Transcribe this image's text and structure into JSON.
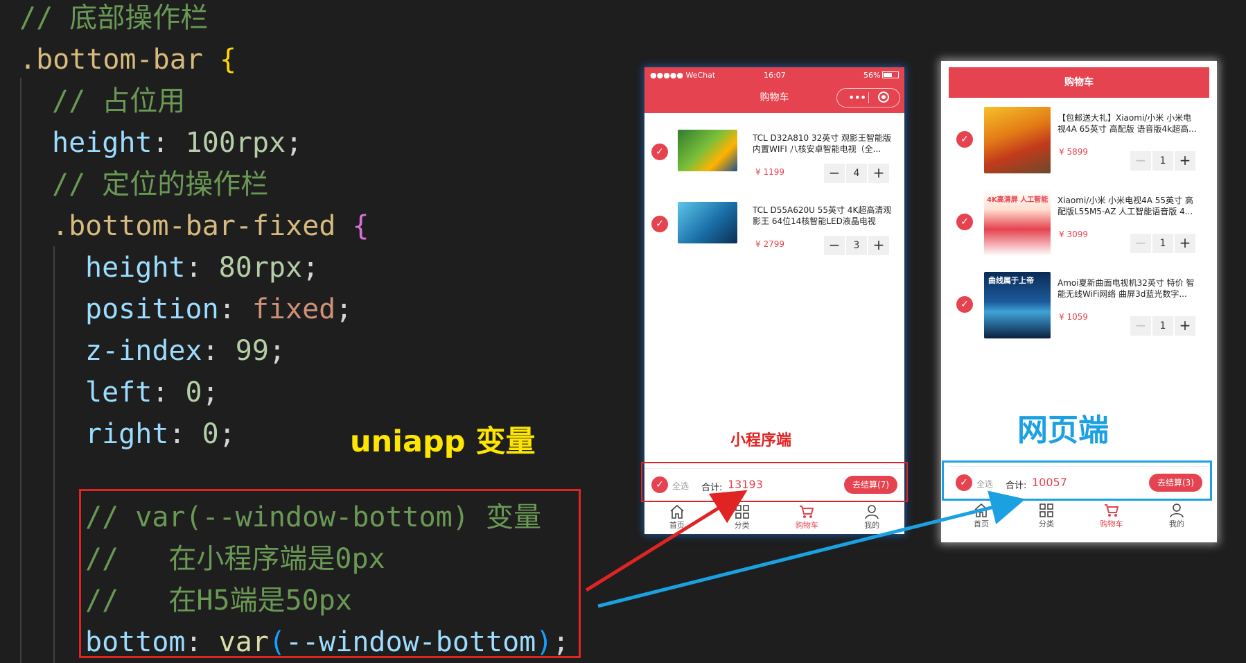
{
  "code": {
    "comment_bottom_bar": "// 底部操作栏",
    "selector_bottom_bar": ".bottom-bar",
    "comment_placeholder": "// 占位用",
    "height_prop": "height",
    "height_val": "100rpx",
    "comment_fixed": "// 定位的操作栏",
    "selector_fixed": ".bottom-bar-fixed",
    "height2_val": "80rpx",
    "position_prop": "position",
    "position_val": "fixed",
    "zindex_prop": "z-index",
    "zindex_val": "99",
    "left_prop": "left",
    "left_val": "0",
    "right_prop": "right",
    "right_val": "0",
    "var_comment_1": "// var(--window-bottom) 变量",
    "var_comment_2": "//   在小程序端是0px",
    "var_comment_3": "//   在H5端是50px",
    "bottom_prop": "bottom",
    "bottom_fn": "var",
    "bottom_arg": "--window-bottom"
  },
  "annotations": {
    "uniapp_variable": "uniapp 变量",
    "mini_program": "小程序端",
    "web": "网页端"
  },
  "colors": {
    "accent_red": "#e5434f",
    "annotation_red": "#e02424",
    "annotation_blue": "#1ba1e2",
    "annotation_yellow": "#ffe600"
  },
  "mini_program": {
    "status": {
      "carrier": "●●●●● WeChat",
      "time": "16:07",
      "battery": "56%"
    },
    "title": "购物车",
    "items": [
      {
        "title": "TCL D32A810 32英寸 观影王智能版内置WIFI 八核安卓智能电视（全...",
        "price": "¥ 1199",
        "qty": "4",
        "brand": "TCL"
      },
      {
        "title": "TCL D55A620U 55英寸 4K超高清观影王 64位14核智能LED液晶电视",
        "price": "¥ 2799",
        "qty": "3",
        "brand": "TCL"
      }
    ],
    "bottom_bar": {
      "select_all": "全选",
      "total_label": "合计:",
      "total": "13193",
      "checkout": "去结算(7)"
    },
    "tabs": [
      {
        "label": "首页",
        "icon": "home-icon"
      },
      {
        "label": "分类",
        "icon": "grid-icon"
      },
      {
        "label": "购物车",
        "icon": "cart-icon"
      },
      {
        "label": "我的",
        "icon": "user-icon"
      }
    ]
  },
  "h5": {
    "title": "购物车",
    "items": [
      {
        "title": "【包邮送大礼】Xiaomi/小米 小米电视4A 65英寸 高配版 语音版4k超高...",
        "price": "¥ 5899",
        "qty": "1"
      },
      {
        "title": "Xiaomi/小米 小米电视4A 55英寸 高配版L55M5-AZ 人工智能语音版 4...",
        "price": "¥ 3099",
        "qty": "1",
        "thumb_text": "4K高清屏 人工智能"
      },
      {
        "title": "Amoi夏新曲面电视机32英寸 特价 智能无线WiFi网络 曲屏3d蓝光数字...",
        "price": "¥ 1059",
        "qty": "1",
        "thumb_text": "曲线属于上帝"
      }
    ],
    "bottom_bar": {
      "select_all": "全选",
      "total_label": "合计:",
      "total": "10057",
      "checkout": "去结算(3)"
    },
    "tabs": [
      {
        "label": "首页",
        "icon": "home-icon"
      },
      {
        "label": "分类",
        "icon": "grid-icon"
      },
      {
        "label": "购物车",
        "icon": "cart-icon"
      },
      {
        "label": "我的",
        "icon": "user-icon"
      }
    ]
  }
}
